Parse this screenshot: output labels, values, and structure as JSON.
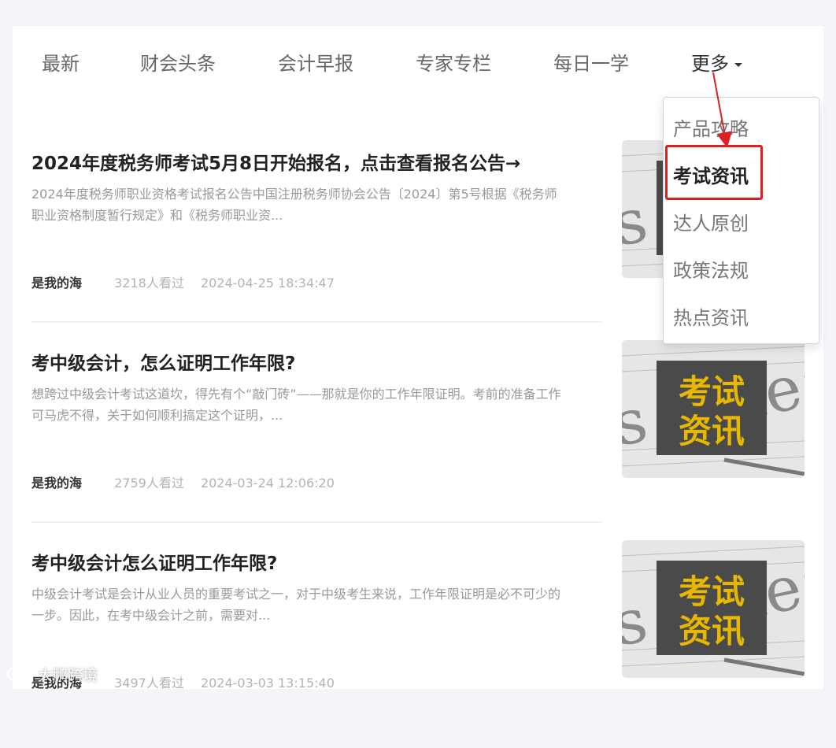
{
  "nav": {
    "items": [
      {
        "label": "最新"
      },
      {
        "label": "财会头条"
      },
      {
        "label": "会计早报"
      },
      {
        "label": "专家专栏"
      },
      {
        "label": "每日一学"
      }
    ],
    "more_label": "更多"
  },
  "dropdown": {
    "items": [
      {
        "label": "产品攻略"
      },
      {
        "label": "考试资讯"
      },
      {
        "label": "达人原创"
      },
      {
        "label": "政策法规"
      },
      {
        "label": "热点资讯"
      }
    ],
    "active_index": 1
  },
  "articles": [
    {
      "title": "2024年度税务师考试5月8日开始报名，点击查看报名公告→",
      "summary": "2024年度税务师职业资格考试报名公告中国注册税务师协会公告〔2024〕第5号根据《税务师职业资格制度暂行规定》和《税务师职业资...",
      "author": "是我的海",
      "views": "3218人看过",
      "datetime": "2024-04-25 18:34:47",
      "thumb_text": [
        "考试",
        "资讯"
      ]
    },
    {
      "title": "考中级会计，怎么证明工作年限?",
      "summary": "想跨过中级会计考试这道坎，得先有个“敲门砖”——那就是你的工作年限证明。考前的准备工作可马虎不得，关于如何顺利搞定这个证明，...",
      "author": "是我的海",
      "views": "2759人看过",
      "datetime": "2024-03-24 12:06:20",
      "thumb_text": [
        "考试",
        "资讯"
      ]
    },
    {
      "title": "考中级会计怎么证明工作年限?",
      "summary": "中级会计考试是会计从业人员的重要考试之一，对于中级考生来说，工作年限证明是必不可少的一步。因此，在考中级会计之前，需要对...",
      "author": "是我的海",
      "views": "3497人看过",
      "datetime": "2024-03-03 13:15:40",
      "thumb_text": [
        "考试",
        "资讯"
      ]
    }
  ],
  "watermark": {
    "text": "大鹏跨境"
  },
  "colors": {
    "highlight": "#e02020",
    "thumb_label": "#e8b800"
  }
}
